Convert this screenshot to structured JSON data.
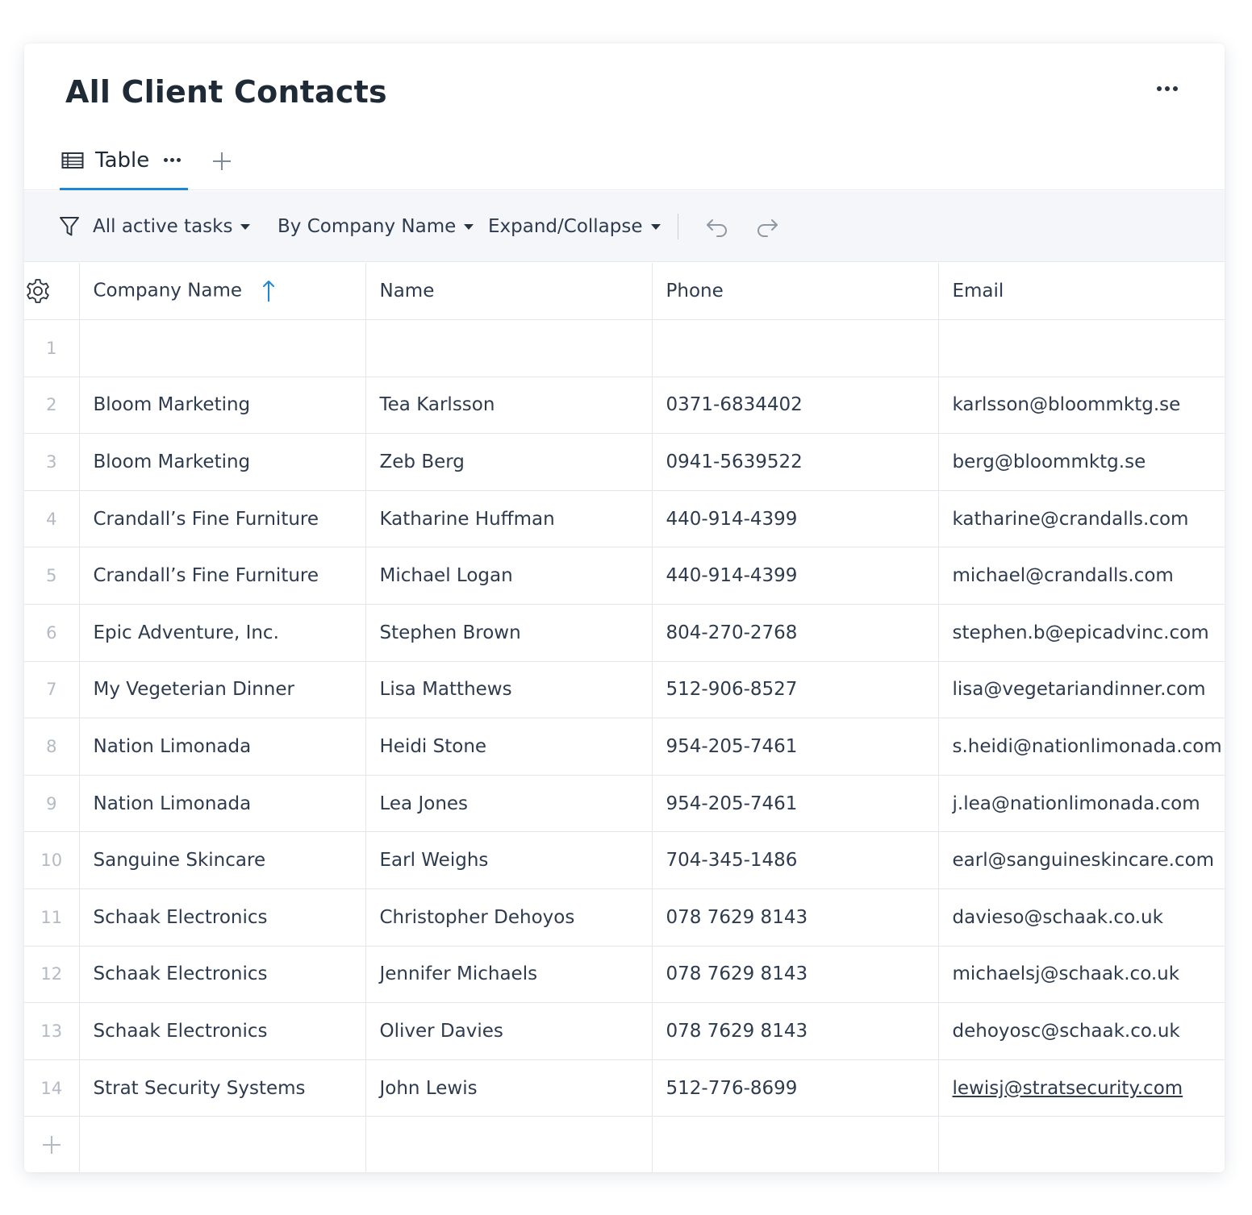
{
  "page": {
    "title": "All Client Contacts",
    "more_icon": "more-horizontal-icon"
  },
  "tabs": [
    {
      "label": "Table",
      "icon": "table-icon",
      "active": true
    }
  ],
  "toolbar": {
    "filter_label": "All active tasks",
    "group_label": "By Company Name",
    "expand_label": "Expand/Collapse"
  },
  "table": {
    "columns": [
      {
        "label": "Company Name",
        "sort": "ascending"
      },
      {
        "label": "Name"
      },
      {
        "label": "Phone"
      },
      {
        "label": "Email"
      }
    ],
    "rows": [
      {
        "num": "1",
        "company": "",
        "name": "",
        "phone": "",
        "email": ""
      },
      {
        "num": "2",
        "company": "Bloom Marketing",
        "name": "Tea Karlsson",
        "phone": "0371-6834402",
        "email": "karlsson@bloommktg.se"
      },
      {
        "num": "3",
        "company": "Bloom Marketing",
        "name": "Zeb Berg",
        "phone": "0941-5639522",
        "email": "berg@bloommktg.se"
      },
      {
        "num": "4",
        "company": "Crandall’s Fine Furniture",
        "name": "Katharine Huffman",
        "phone": "440-914-4399",
        "email": "katharine@crandalls.com"
      },
      {
        "num": "5",
        "company": "Crandall’s Fine Furniture",
        "name": "Michael Logan",
        "phone": "440-914-4399",
        "email": "michael@crandalls.com"
      },
      {
        "num": "6",
        "company": "Epic Adventure, Inc.",
        "name": "Stephen Brown",
        "phone": "804-270-2768",
        "email": "stephen.b@epicadvinc.com"
      },
      {
        "num": "7",
        "company": "My Vegeterian Dinner",
        "name": "Lisa Matthews",
        "phone": "512-906-8527",
        "email": "lisa@vegetariandinner.com"
      },
      {
        "num": "8",
        "company": "Nation Limonada",
        "name": "Heidi Stone",
        "phone": "954-205-7461",
        "email": "s.heidi@nationlimonada.com"
      },
      {
        "num": "9",
        "company": "Nation Limonada",
        "name": "Lea Jones",
        "phone": "954-205-7461",
        "email": "j.lea@nationlimonada.com"
      },
      {
        "num": "10",
        "company": "Sanguine Skincare",
        "name": "Earl Weighs",
        "phone": "704-345-1486",
        "email": "earl@sanguineskincare.com"
      },
      {
        "num": "11",
        "company": "Schaak Electronics",
        "name": "Christopher Dehoyos",
        "phone": "078 7629 8143",
        "email": "davieso@schaak.co.uk"
      },
      {
        "num": "12",
        "company": "Schaak Electronics",
        "name": "Jennifer Michaels",
        "phone": "078 7629 8143",
        "email": "michaelsj@schaak.co.uk"
      },
      {
        "num": "13",
        "company": "Schaak Electronics",
        "name": "Oliver Davies",
        "phone": "078 7629 8143",
        "email": "dehoyosc@schaak.co.uk"
      },
      {
        "num": "14",
        "company": "Strat Security Systems",
        "name": "John Lewis",
        "phone": "512-776-8699",
        "email": "lewisj@stratsecurity.com",
        "email_link": true
      }
    ]
  },
  "colors": {
    "accent": "#1c86d9",
    "text": "#2e3b4e",
    "row_number": "#b3bac4",
    "toolbar_bg": "#f4f6f9"
  }
}
